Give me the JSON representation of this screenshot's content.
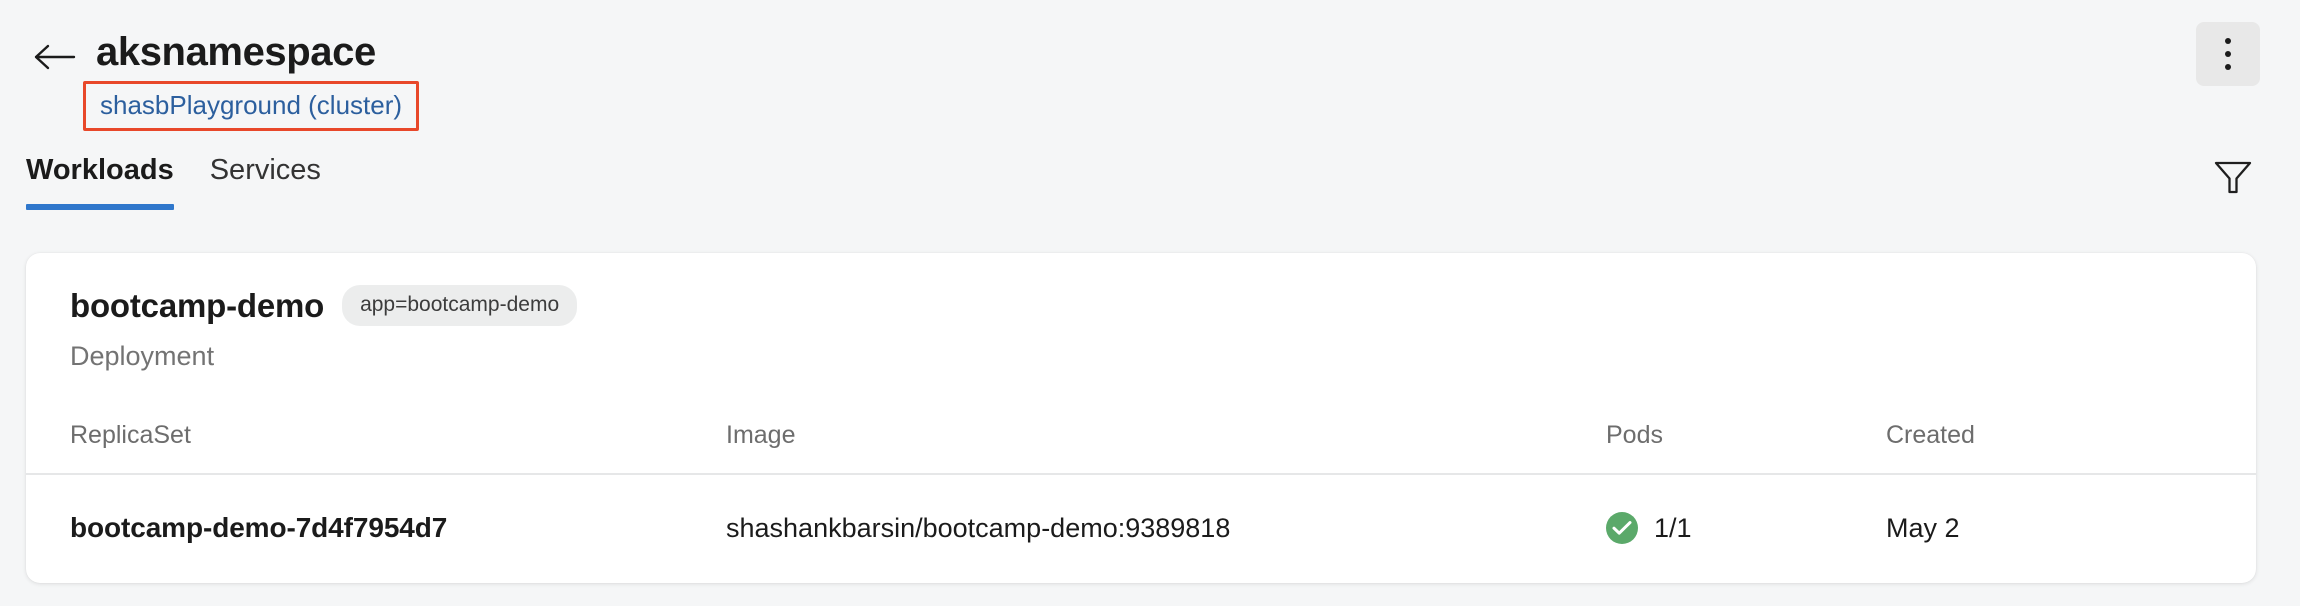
{
  "header": {
    "back_icon": "arrow-left-icon",
    "title": "aksnamespace",
    "cluster_link": "shasbPlayground (cluster)",
    "cluster_link_color": "#2c5f9e",
    "highlight_color": "#e8482a",
    "kebab_icon": "more-vertical-icon"
  },
  "tabs": {
    "items": [
      {
        "label": "Workloads",
        "active": true
      },
      {
        "label": "Services",
        "active": false
      }
    ],
    "active_underline_color": "#2f77cc",
    "filter_icon": "filter-funnel-icon"
  },
  "workload": {
    "name": "bootcamp-demo",
    "label_chip": "app=bootcamp-demo",
    "kind": "Deployment"
  },
  "table": {
    "columns": [
      "ReplicaSet",
      "Image",
      "Pods",
      "Created"
    ],
    "rows": [
      {
        "replicaset": "bootcamp-demo-7d4f7954d7",
        "image": "shashankbarsin/bootcamp-demo:9389818",
        "pods": "1/1",
        "pods_status_icon": "check-circle-icon",
        "pods_status_color": "#5ba96a",
        "created": "May 2"
      }
    ]
  }
}
